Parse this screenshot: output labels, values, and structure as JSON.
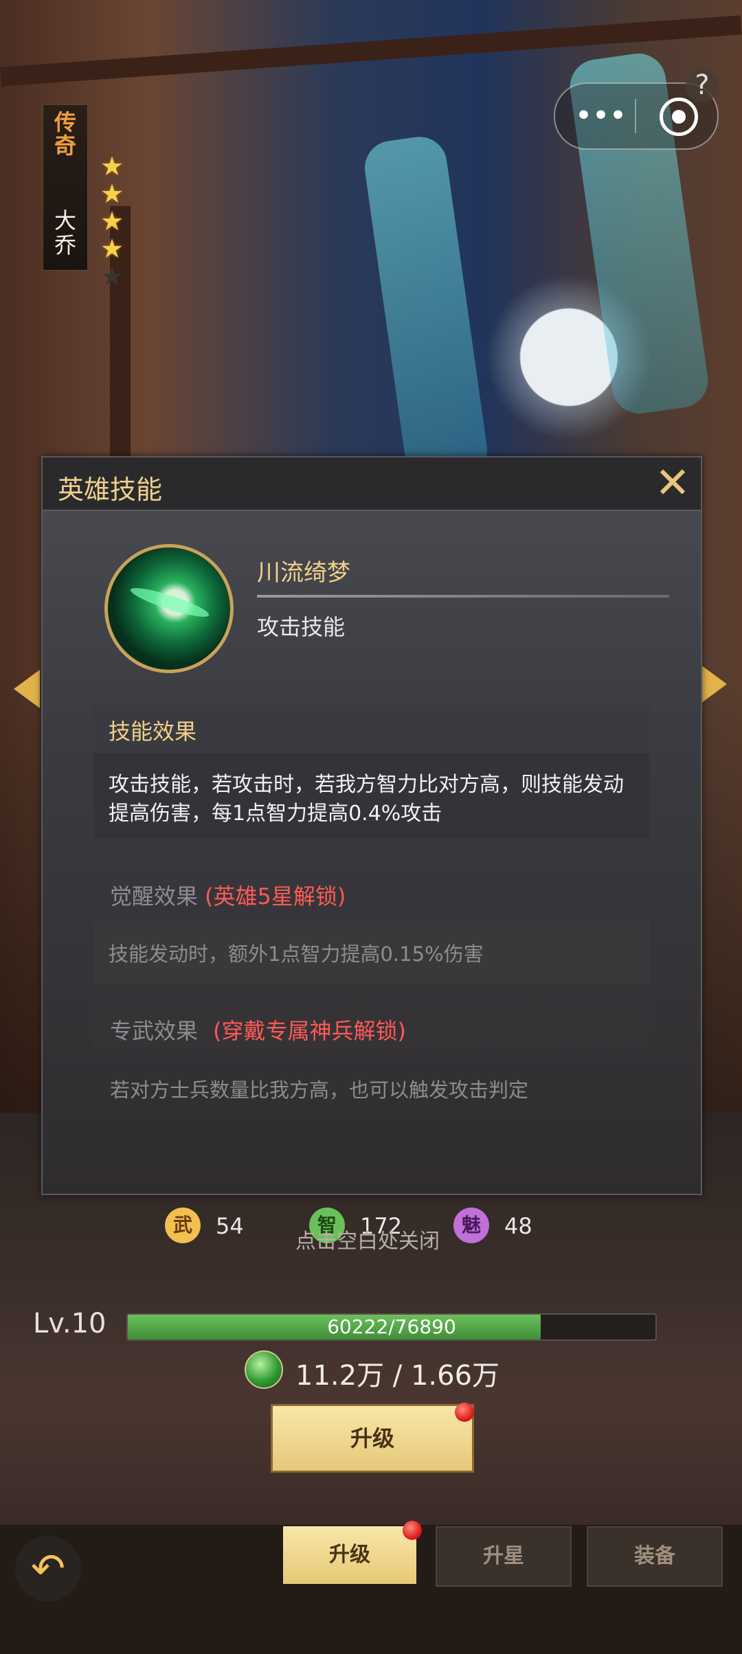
{
  "hero": {
    "rarity": "传奇",
    "name": "大乔",
    "stars_filled": 4,
    "stars_total": 5
  },
  "modal": {
    "title": "英雄技能",
    "close_icon": "close-x-icon",
    "skill": {
      "name": "川流绮梦",
      "type": "攻击技能"
    },
    "effect": {
      "heading": "技能效果",
      "text": "攻击技能，若攻击时，若我方智力比对方高，则技能发动提高伤害，每1点智力提高0.4%攻击"
    },
    "awaken": {
      "heading": "觉醒效果",
      "lock_text": "(英雄5星解锁)",
      "text": "技能发动时，额外1点智力提高0.15%伤害"
    },
    "weapon": {
      "heading": "专武效果",
      "lock_text": "(穿戴专属神兵解锁)",
      "text": "若对方士兵数量比我方高，也可以触发攻击判定"
    }
  },
  "stats": [
    {
      "badge": "武",
      "value": "54",
      "color": "#f0c050"
    },
    {
      "badge": "智",
      "value": "172",
      "color": "#6cc05c"
    },
    {
      "badge": "魅",
      "value": "48",
      "color": "#c070d8"
    }
  ],
  "close_hint": "点击空白处关闭",
  "level": {
    "label": "Lv.10",
    "xp_text": "60222/76890",
    "xp_fraction": 0.783
  },
  "resources": {
    "text": "11.2万 / 1.66万"
  },
  "buttons": {
    "upgrade": "升级"
  },
  "tabs": [
    {
      "label": "升级",
      "active": true
    },
    {
      "label": "升星",
      "active": false
    },
    {
      "label": "装备",
      "active": false
    }
  ],
  "capsule": {
    "more_glyph": "•••",
    "help_glyph": "?"
  },
  "colors": {
    "accent_gold": "#f1d08a",
    "lock_red": "#ff5a55",
    "xp_green": "#6cc05c"
  }
}
